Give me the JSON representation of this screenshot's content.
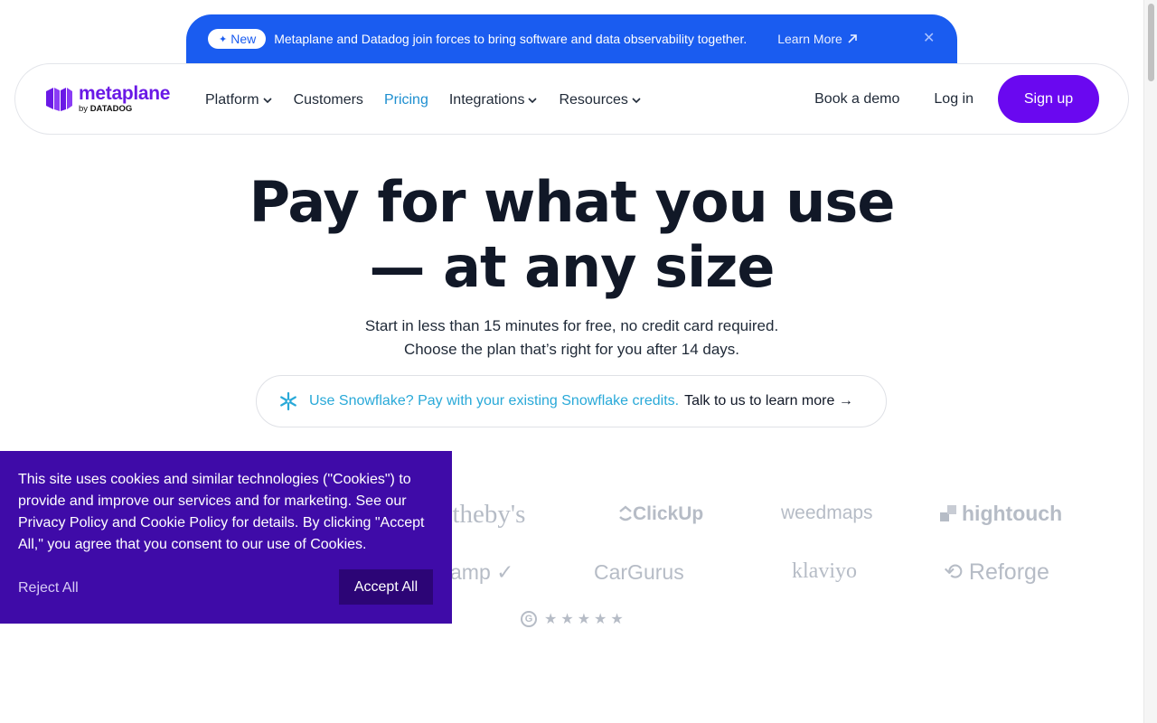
{
  "announcement": {
    "badge": "New",
    "message": "Metaplane and Datadog join forces to bring software and data observability together.",
    "link": "Learn More",
    "close_icon": "close-icon"
  },
  "nav": {
    "brand": "metaplane",
    "by": "by",
    "by_company": "DATADOG",
    "items": [
      {
        "label": "Platform",
        "dropdown": true
      },
      {
        "label": "Customers",
        "dropdown": false
      },
      {
        "label": "Pricing",
        "dropdown": false,
        "active": true
      },
      {
        "label": "Integrations",
        "dropdown": true
      },
      {
        "label": "Resources",
        "dropdown": true
      }
    ],
    "book_demo": "Book a demo",
    "login": "Log in",
    "signup": "Sign up"
  },
  "hero": {
    "title_line1": "Pay for what you use",
    "title_line2": "— at any size",
    "sub_line1": "Start in less than 15 minutes for free, no credit card required.",
    "sub_line2": "Choose the plan that’s right for you after 14 days.",
    "snowflake_text": "Use Snowflake? Pay with your existing Snowflake credits.",
    "snowflake_cta": "Talk to us to learn more →"
  },
  "customer_logos": [
    "otheby's",
    "ClickUp",
    "weedmaps",
    "hightouch",
    "amp",
    "CarGurus",
    "klaviyo",
    "Reforge"
  ],
  "rating": {
    "stars": 5,
    "icon": "g2-icon"
  },
  "cookie": {
    "text_1": "This site uses cookies and similar technologies (\"Cookies\") to provide and improve our services and for marketing. See our ",
    "privacy": "Privacy Policy",
    "and": " and ",
    "cookie_policy": "Cookie Policy",
    "text_2": " for details. By clicking \"Accept All,\" you agree that you consent to our use of Cookies.",
    "reject": "Reject All",
    "accept": "Accept All"
  },
  "colors": {
    "brand_purple": "#6a08f0",
    "announce_blue": "#1a5cf0",
    "cookie_bg": "#3f0ba8",
    "link_blue": "#1e8fd0",
    "snowflake_blue": "#29a9d8"
  }
}
